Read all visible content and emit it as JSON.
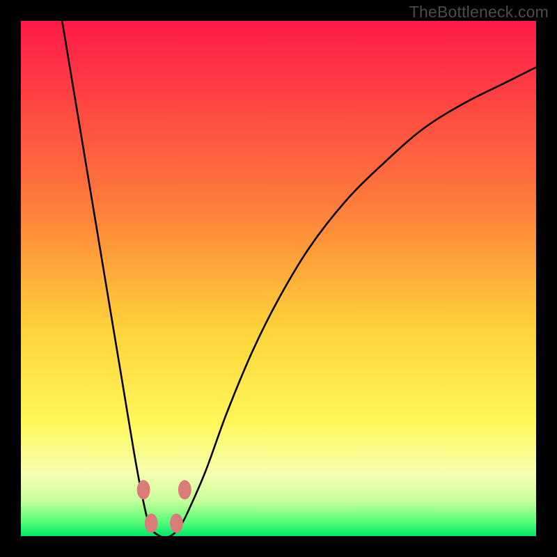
{
  "watermark": "TheBottleneck.com",
  "chart_data": {
    "type": "line",
    "title": "",
    "xlabel": "",
    "ylabel": "",
    "xlim": [
      0,
      100
    ],
    "ylim": [
      0,
      100
    ],
    "gradient_stops": [
      {
        "offset": 0,
        "color": "#ff1a49"
      },
      {
        "offset": 35,
        "color": "#ff7a3a"
      },
      {
        "offset": 60,
        "color": "#ffd33a"
      },
      {
        "offset": 78,
        "color": "#fff75a"
      },
      {
        "offset": 88,
        "color": "#f6ffb0"
      },
      {
        "offset": 93,
        "color": "#c9ff9a"
      },
      {
        "offset": 97,
        "color": "#5fff7a"
      },
      {
        "offset": 100,
        "color": "#00e868"
      }
    ],
    "series": [
      {
        "name": "bottleneck-curve",
        "x": [
          8,
          10,
          12,
          14,
          16,
          18,
          20,
          22,
          23.5,
          25,
          27,
          29,
          31,
          33,
          36,
          40,
          45,
          50,
          56,
          63,
          70,
          78,
          86,
          94,
          100
        ],
        "y": [
          100,
          88,
          76,
          64,
          52,
          40,
          28,
          16,
          8,
          2,
          0,
          0,
          2,
          6,
          13,
          24,
          36,
          46,
          56,
          65,
          72,
          79,
          84,
          88,
          91
        ]
      }
    ],
    "markers": [
      {
        "x": 23.8,
        "y": 9
      },
      {
        "x": 25.3,
        "y": 2.5
      },
      {
        "x": 30.2,
        "y": 2.5
      },
      {
        "x": 31.8,
        "y": 9
      }
    ],
    "marker_radius": 1.5
  }
}
